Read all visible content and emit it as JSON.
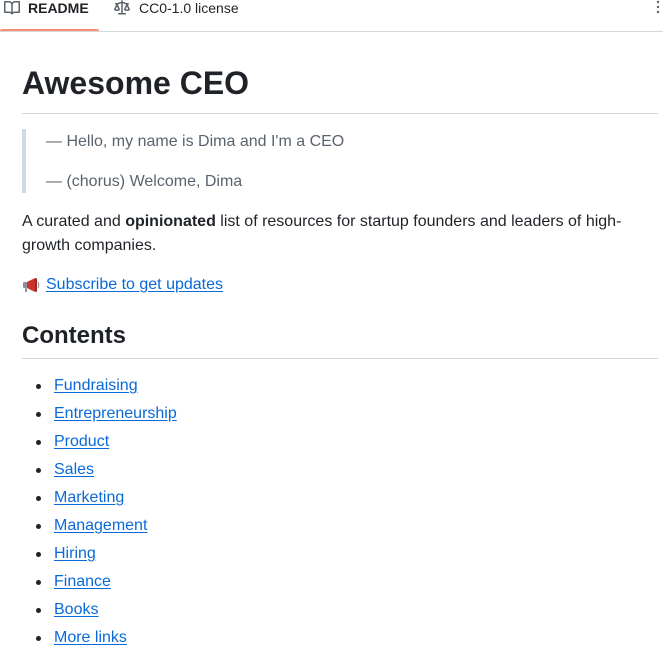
{
  "tabs": [
    {
      "label": "README",
      "icon": "book-icon",
      "active": true
    },
    {
      "label": "CC0-1.0 license",
      "icon": "scale-icon",
      "active": false
    }
  ],
  "readme": {
    "title": "Awesome CEO",
    "quote_lines": [
      "— Hello, my name is Dima and I'm a CEO",
      "— (chorus) Welcome, Dima"
    ],
    "intro": {
      "before": "A curated and ",
      "bold": "opinionated",
      "after": " list of resources for startup founders and leaders of high-growth companies."
    },
    "subscribe": {
      "icon": "megaphone-icon",
      "link_text": "Subscribe to get updates"
    },
    "contents_title": "Contents",
    "contents_items": [
      "Fundraising",
      "Entrepreneurship",
      "Product",
      "Sales",
      "Marketing",
      "Management",
      "Hiring",
      "Finance",
      "Books",
      "More links"
    ]
  },
  "colors": {
    "link": "#0969da",
    "text": "#1f2328",
    "muted": "#59636e",
    "border": "#d1d9e0",
    "active_tab_underline": "#fd8c73"
  }
}
